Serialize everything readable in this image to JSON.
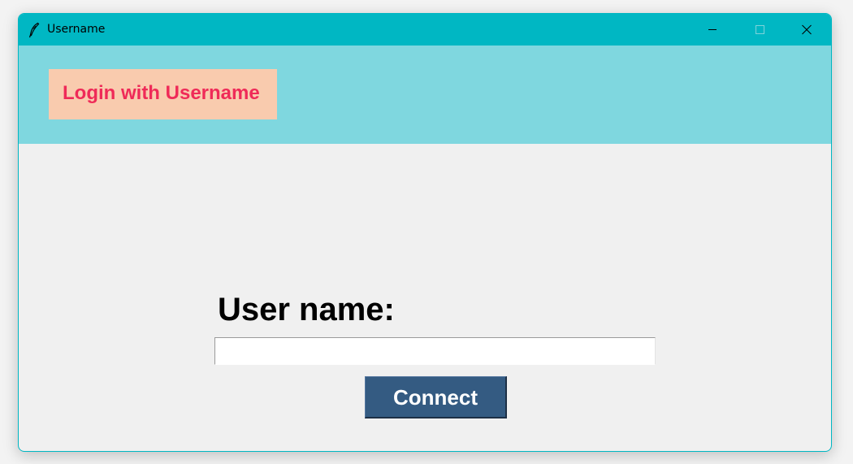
{
  "window": {
    "title": "Username",
    "icon": "feather-icon",
    "controls": {
      "minimize_icon": "minimize-icon",
      "maximize_icon": "maximize-icon",
      "close_icon": "close-icon"
    }
  },
  "header": {
    "badge_text": "Login with Username"
  },
  "form": {
    "username_label": "User name:",
    "username_value": "",
    "connect_label": "Connect"
  },
  "colors": {
    "titlebar": "#00b7c3",
    "header_bg": "#7fd7df",
    "badge_bg": "#f9cbae",
    "badge_text": "#ef2a58",
    "body_bg": "#f0f0f0",
    "button_bg": "#345b82",
    "button_text": "#ffffff"
  }
}
